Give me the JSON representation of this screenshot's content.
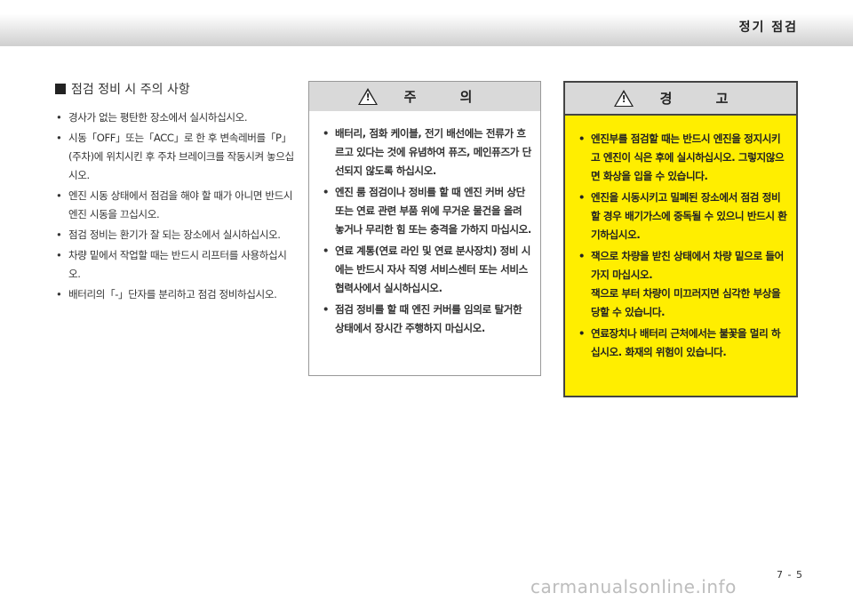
{
  "header": {
    "title": "정기 점검"
  },
  "section": {
    "title": "점검 정비 시 주의 사항",
    "items": [
      "경사가 없는 평탄한 장소에서 실시하십시오.",
      "시동「OFF」또는「ACC」로 한 후 변속레버를「P」(주차)에 위치시킨 후 주차 브레이크를 작동시켜 놓으십시오.",
      "엔진 시동 상태에서 점검을 해야 할 때가 아니면 반드시 엔진 시동을 끄십시오.",
      "점검 정비는 환기가 잘 되는 장소에서 실시하십시오.",
      "차량 밑에서 작업할 때는 반드시 리프터를 사용하십시오.",
      "배터리의「-」단자를 분리하고 점검 정비하십시오."
    ]
  },
  "caution": {
    "icon_text": "!",
    "title": "주 의",
    "items": [
      "배터리, 점화 케이블, 전기 배선에는 전류가 흐르고 있다는 것에 유념하여 퓨즈, 메인퓨즈가 단선되지 않도록 하십시오.",
      "엔진 룸 점검이나 정비를 할 때 엔진 커버 상단 또는 연료 관련 부품 위에 무거운 물건을 올려 놓거나 무리한 힘 또는 충격을 가하지 마십시오.",
      "연료 계통(연료 라인 및 연료 분사장치) 정비 시에는 반드시 자사 직영 서비스센터 또는 서비스협력사에서 실시하십시오.",
      "점검 정비를 할 때 엔진 커버를 임의로 탈거한 상태에서 장시간 주행하지 마십시오."
    ]
  },
  "warning": {
    "icon_text": "!",
    "title": "경 고",
    "items": [
      {
        "text": "엔진부를 점검할 때는 반드시 엔진을 정지시키고 엔진이 식은 후에 실시하십시오. 그렇지않으면 화상을 입을 수 있습니다.",
        "extra": ""
      },
      {
        "text": "엔진을 시동시키고 밀폐된 장소에서 점검 정비할 경우 배기가스에 중독될 수 있으니 반드시 환기하십시오.",
        "extra": ""
      },
      {
        "text": "잭으로 차량을 받친 상태에서 차량 밑으로 들어가지 마십시오.",
        "extra": "잭으로 부터 차량이 미끄러지면 심각한 부상을 당할 수 있습니다."
      },
      {
        "text": "연료장치나 배터리 근처에서는 불꽃을 멀리 하십시오. 화재의 위험이 있습니다.",
        "extra": ""
      }
    ]
  },
  "page_number": "7 - 5",
  "watermark": "carmanualsonline.info",
  "colors": {
    "warning_bg": "#ffee00",
    "header_gray": "#d9d9d9"
  }
}
